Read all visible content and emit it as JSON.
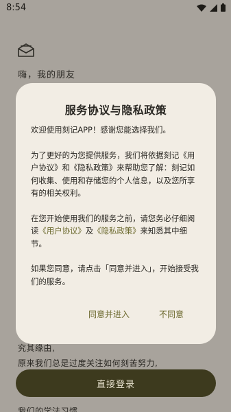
{
  "status_bar": {
    "time": "8:54"
  },
  "background": {
    "greeting": "嗨，我的朋友",
    "lines": [
      "究其缘由,",
      "原来我们总是过度关注如何刻苦努力,",
      "我们的学法习惯"
    ],
    "login_button": "直接登录"
  },
  "dialog": {
    "title": "服务协议与隐私政策",
    "p1": "欢迎使用刻记APP！感谢您能选择我们。",
    "p2": "为了更好的为您提供服务，我们将依据刻记《用户协议》和《隐私政策》来帮助您了解：刻记如何收集、使用和存储您的个人信息，以及您所享有的相关权利。",
    "p3_prefix": "在您开始使用我们的服务之前，请您务必仔细阅读",
    "p3_link1": "《用户协议》",
    "p3_mid": "及",
    "p3_link2": "《隐私政策》",
    "p3_suffix": "来知悉其中细节。",
    "p4": "如果您同意，请点击「同意并进入」，开始接受我们的服务。",
    "agree_button": "同意并进入",
    "disagree_button": "不同意"
  },
  "colors": {
    "scrim": "#a8a39c",
    "dialog_bg": "#f2ede4",
    "accent": "#6d6a2f",
    "login_button_bg": "#3d3a1e"
  }
}
